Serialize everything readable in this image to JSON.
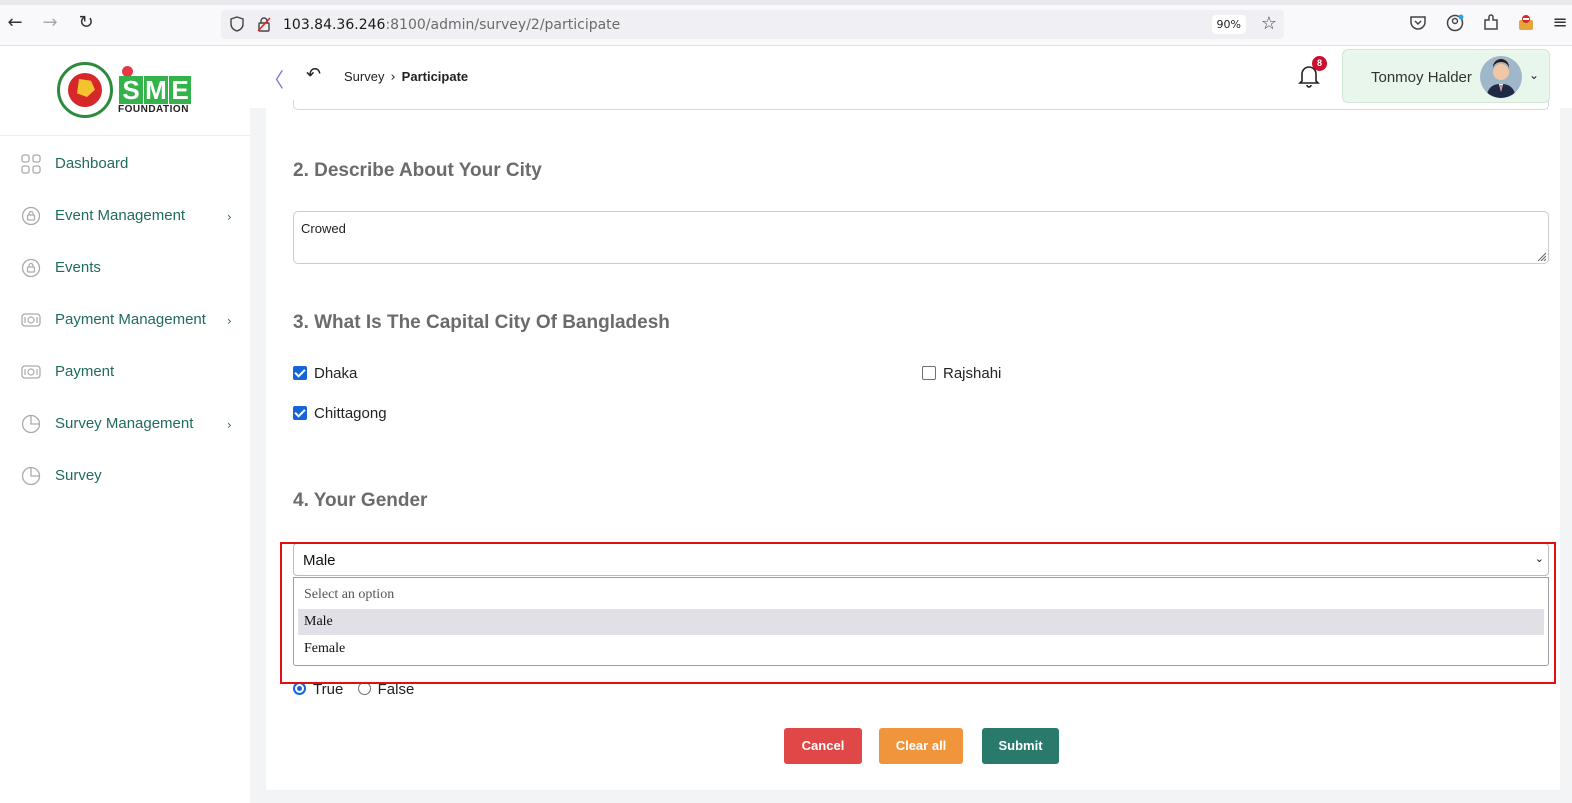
{
  "browser": {
    "url_host": "103.84.36.246",
    "url_rest": ":8100/admin/survey/2/participate",
    "zoom": "90%"
  },
  "sidebar": {
    "logo_text": "SME",
    "logo_subtitle": "FOUNDATION",
    "items": [
      {
        "label": "Dashboard",
        "icon": "grid-icon",
        "has_arrow": false
      },
      {
        "label": "Event Management",
        "icon": "lock-icon",
        "has_arrow": true
      },
      {
        "label": "Events",
        "icon": "lock-icon",
        "has_arrow": false
      },
      {
        "label": "Payment Management",
        "icon": "money-icon",
        "has_arrow": true
      },
      {
        "label": "Payment",
        "icon": "money-icon",
        "has_arrow": false
      },
      {
        "label": "Survey Management",
        "icon": "pie-icon",
        "has_arrow": true
      },
      {
        "label": "Survey",
        "icon": "pie-icon",
        "has_arrow": false
      }
    ],
    "arrow": "›"
  },
  "header": {
    "breadcrumb": {
      "parent": "Survey",
      "current": "Participate"
    },
    "notification_count": "8",
    "user_name": "Tonmoy Halder"
  },
  "survey": {
    "q2": {
      "title": "2. Describe About Your City",
      "answer": "Crowed"
    },
    "q3": {
      "title": "3. What Is The Capital City Of Bangladesh",
      "options": [
        {
          "label": "Dhaka",
          "checked": true
        },
        {
          "label": "Rajshahi",
          "checked": false
        },
        {
          "label": "Chittagong",
          "checked": true
        }
      ]
    },
    "q4": {
      "title": "4. Your Gender",
      "selected": "Male",
      "options": [
        "Select an option",
        "Male",
        "Female"
      ]
    },
    "q5": {
      "options": [
        {
          "label": "True",
          "selected": true
        },
        {
          "label": "False",
          "selected": false
        }
      ]
    }
  },
  "actions": {
    "cancel": "Cancel",
    "clear_all": "Clear all",
    "submit": "Submit"
  },
  "colors": {
    "accent_teal": "#2a7a6c",
    "cancel_red": "#e04848",
    "clear_orange": "#f0953c",
    "checkbox_blue": "#1565d8",
    "highlight_red": "#e01010"
  }
}
